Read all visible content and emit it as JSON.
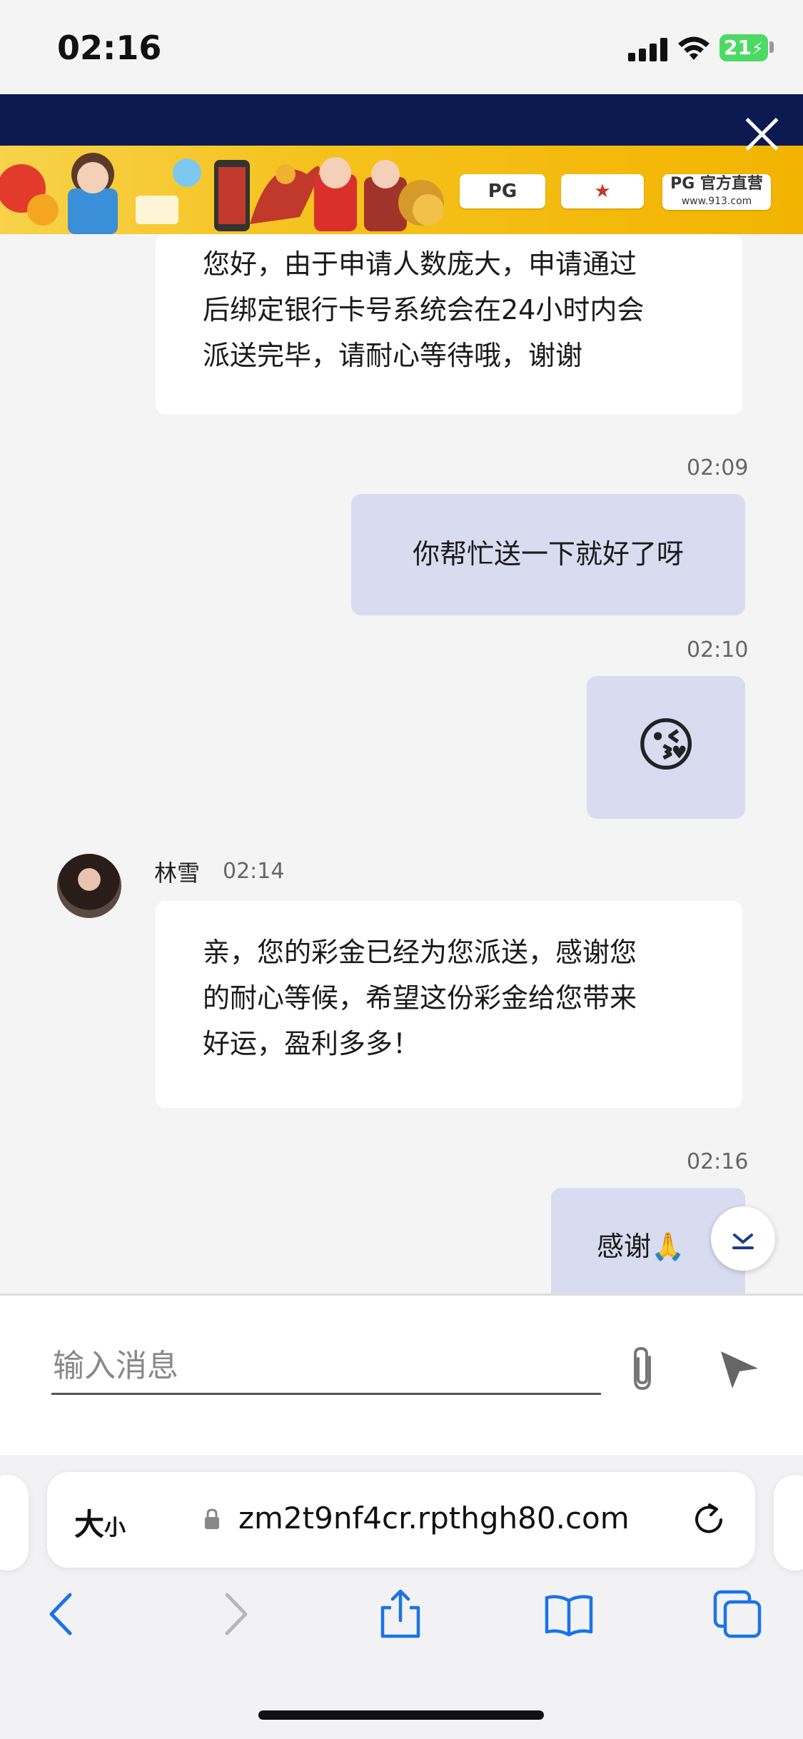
{
  "status": {
    "time": "02:16",
    "battery": "21"
  },
  "messages": [
    {
      "direction": "in",
      "text_lines": [
        "您好，由于申请人数庞大，申请通过",
        "后绑定银行卡号系统会在24小时内会",
        "派送完毕，请耐心等待哦，谢谢"
      ]
    },
    {
      "direction": "out",
      "time": "02:09",
      "text": "你帮忙送一下就好了呀"
    },
    {
      "direction": "out",
      "time": "02:10",
      "text": "😘"
    },
    {
      "direction": "in",
      "sender": "林雪",
      "time": "02:14",
      "text_lines": [
        "亲，您的彩金已经为您派送，感谢您",
        "的耐心等候，希望这份彩金给您带来",
        "好运，盈利多多！"
      ]
    },
    {
      "direction": "out",
      "time": "02:16",
      "text": "感谢🙏"
    }
  ],
  "input": {
    "placeholder": "输入消息"
  },
  "browser": {
    "text_size_big": "大",
    "text_size_small": "小",
    "url": "zm2t9nf4cr.rpthgh80.com"
  },
  "banner": {
    "badges": [
      "PG",
      "PG 官方直营"
    ],
    "badge_sub": "www.913.com"
  },
  "icons": [
    "close-icon",
    "paperclip-icon",
    "send-icon",
    "lock-icon",
    "reload-icon",
    "back-icon",
    "forward-icon",
    "share-icon",
    "bookmarks-icon",
    "tabs-icon",
    "chevron-down-icon",
    "signal-icon",
    "wifi-icon",
    "battery-icon"
  ],
  "colors": {
    "banner_dark": "#0d1a52",
    "banner_gold": "#f5c21d",
    "outgoing_bubble": "#d9dcf1",
    "incoming_bubble": "#ffffff",
    "safari_blue": "#1a73e8"
  }
}
